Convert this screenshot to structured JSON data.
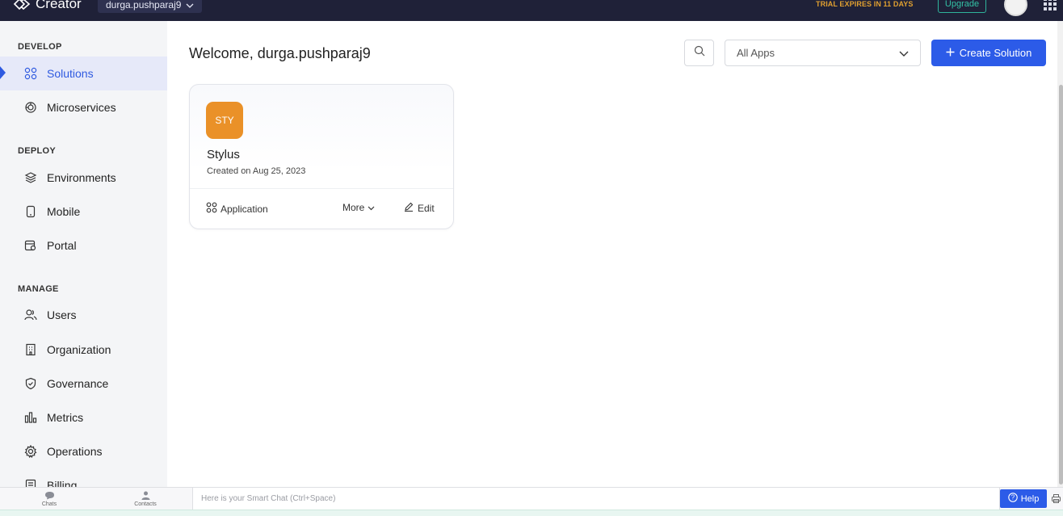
{
  "topbar": {
    "brand": "Creator",
    "org_selector": "durga.pushparaj9",
    "trial_notice": "TRIAL EXPIRES IN 11 DAYS",
    "upgrade_label": "Upgrade"
  },
  "sidebar": {
    "sections": [
      {
        "title": "DEVELOP",
        "items": [
          {
            "label": "Solutions",
            "icon": "solutions-icon",
            "active": true
          },
          {
            "label": "Microservices",
            "icon": "microservices-icon"
          }
        ]
      },
      {
        "title": "DEPLOY",
        "items": [
          {
            "label": "Environments",
            "icon": "layers-icon"
          },
          {
            "label": "Mobile",
            "icon": "mobile-icon"
          },
          {
            "label": "Portal",
            "icon": "portal-icon"
          }
        ]
      },
      {
        "title": "MANAGE",
        "items": [
          {
            "label": "Users",
            "icon": "users-icon"
          },
          {
            "label": "Organization",
            "icon": "building-icon"
          },
          {
            "label": "Governance",
            "icon": "shield-icon"
          },
          {
            "label": "Metrics",
            "icon": "metrics-icon"
          },
          {
            "label": "Operations",
            "icon": "gear-icon"
          },
          {
            "label": "Billing",
            "icon": "billing-icon"
          }
        ]
      }
    ]
  },
  "main": {
    "welcome": "Welcome, durga.pushparaj9",
    "app_filter": "All Apps",
    "create_label": "Create Solution",
    "cards": [
      {
        "badge": "STY",
        "badge_color": "#ea9128",
        "title": "Stylus",
        "created": "Created on Aug 25, 2023",
        "type": "Application",
        "more_label": "More",
        "edit_label": "Edit"
      }
    ]
  },
  "bottombar": {
    "chats_label": "Chats",
    "contacts_label": "Contacts",
    "smart_chat_placeholder": "Here is your Smart Chat (Ctrl+Space)",
    "help_label": "Help"
  },
  "colors": {
    "topbar": "#1f2138",
    "accent": "#2c5be8",
    "trial": "#e0a030",
    "upgrade": "#33c2a6"
  }
}
